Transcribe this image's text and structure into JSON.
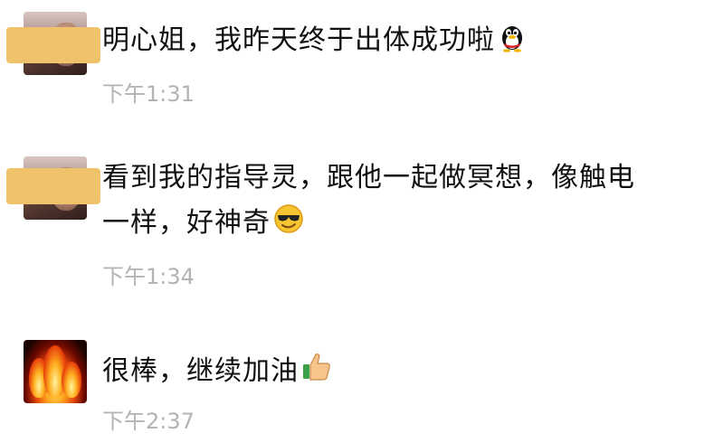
{
  "messages": [
    {
      "text": "明心姐，我昨天终于出体成功啦",
      "emoji": "qq-penguin-icon",
      "time": "下午1:31"
    },
    {
      "line1": "看到我的指导灵，跟他一起做冥想，像触电",
      "line2": "一样，好神奇",
      "emoji": "cool-sunglasses-icon",
      "time": "下午1:34"
    },
    {
      "text": "很棒，继续加油",
      "emoji": "thumbs-up-icon",
      "time": "下午2:37"
    }
  ],
  "colors": {
    "name_mask": "#f0c36a",
    "timestamp": "#b3b3b3",
    "text": "#111111"
  }
}
